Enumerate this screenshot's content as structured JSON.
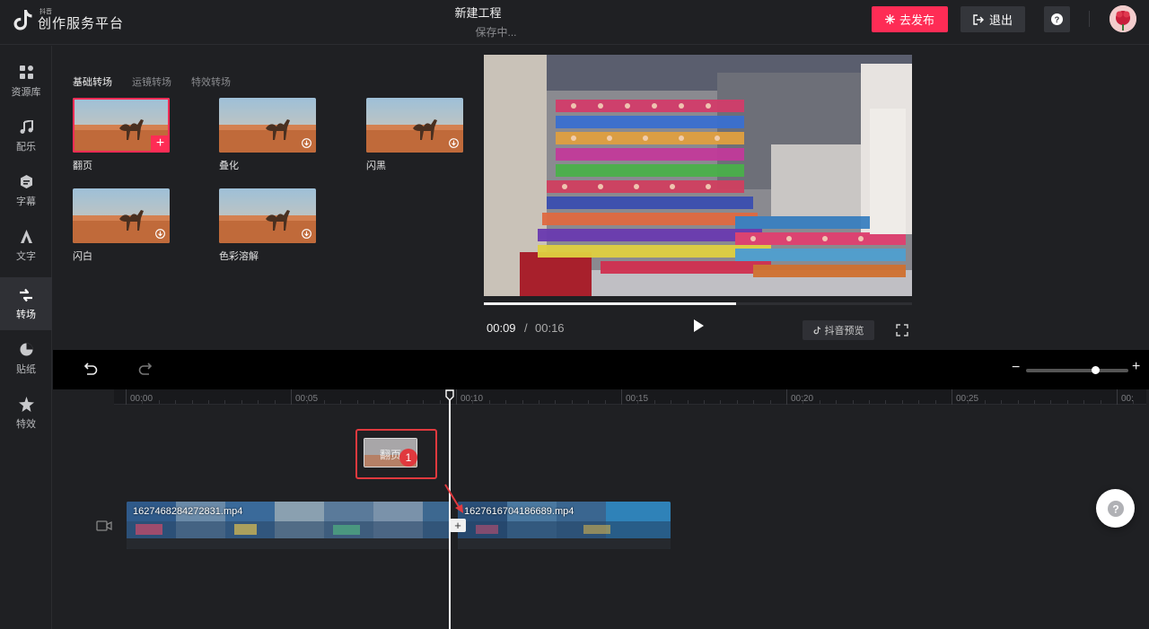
{
  "header": {
    "logo_sub": "抖音",
    "logo_main": "创作服务平台",
    "project_title": "新建工程",
    "project_status": "保存中...",
    "publish_label": "去发布",
    "exit_label": "退出"
  },
  "nav": {
    "items": [
      {
        "label": "资源库",
        "icon": "grid-icon"
      },
      {
        "label": "配乐",
        "icon": "music-note-icon"
      },
      {
        "label": "字幕",
        "icon": "subtitle-icon"
      },
      {
        "label": "文字",
        "icon": "text-icon"
      },
      {
        "label": "转场",
        "icon": "transition-icon",
        "active": true
      },
      {
        "label": "贴纸",
        "icon": "sticker-icon"
      },
      {
        "label": "特效",
        "icon": "effects-star-icon"
      }
    ]
  },
  "transitions": {
    "tabs": [
      "基础转场",
      "运镜转场",
      "特效转场"
    ],
    "active_tab": "基础转场",
    "items": [
      {
        "label": "翻页",
        "selected": true
      },
      {
        "label": "叠化"
      },
      {
        "label": "闪黑"
      },
      {
        "label": "闪白"
      },
      {
        "label": "色彩溶解"
      }
    ]
  },
  "preview": {
    "current_time": "00:09",
    "separator": "/",
    "total_time": "00:16",
    "progress_percent": 59,
    "douyin_preview_label": "抖音预览"
  },
  "toolbar": {
    "zoom_minus": "−",
    "zoom_plus": "+",
    "zoom_percent": 68
  },
  "timeline": {
    "ticks": [
      "00:00",
      "00:05",
      "00:10",
      "00:15",
      "00:20",
      "00:25",
      "00:"
    ],
    "transition_chip_label": "翻页",
    "badge_number": "1",
    "clips": [
      {
        "name": "1627468284272831.mp4"
      },
      {
        "name": "1627616704186689.mp4"
      }
    ],
    "join_label": "+"
  },
  "colors": {
    "accent": "#fe2c55",
    "highlight_box": "#e0393e",
    "background": "#1f2023"
  }
}
